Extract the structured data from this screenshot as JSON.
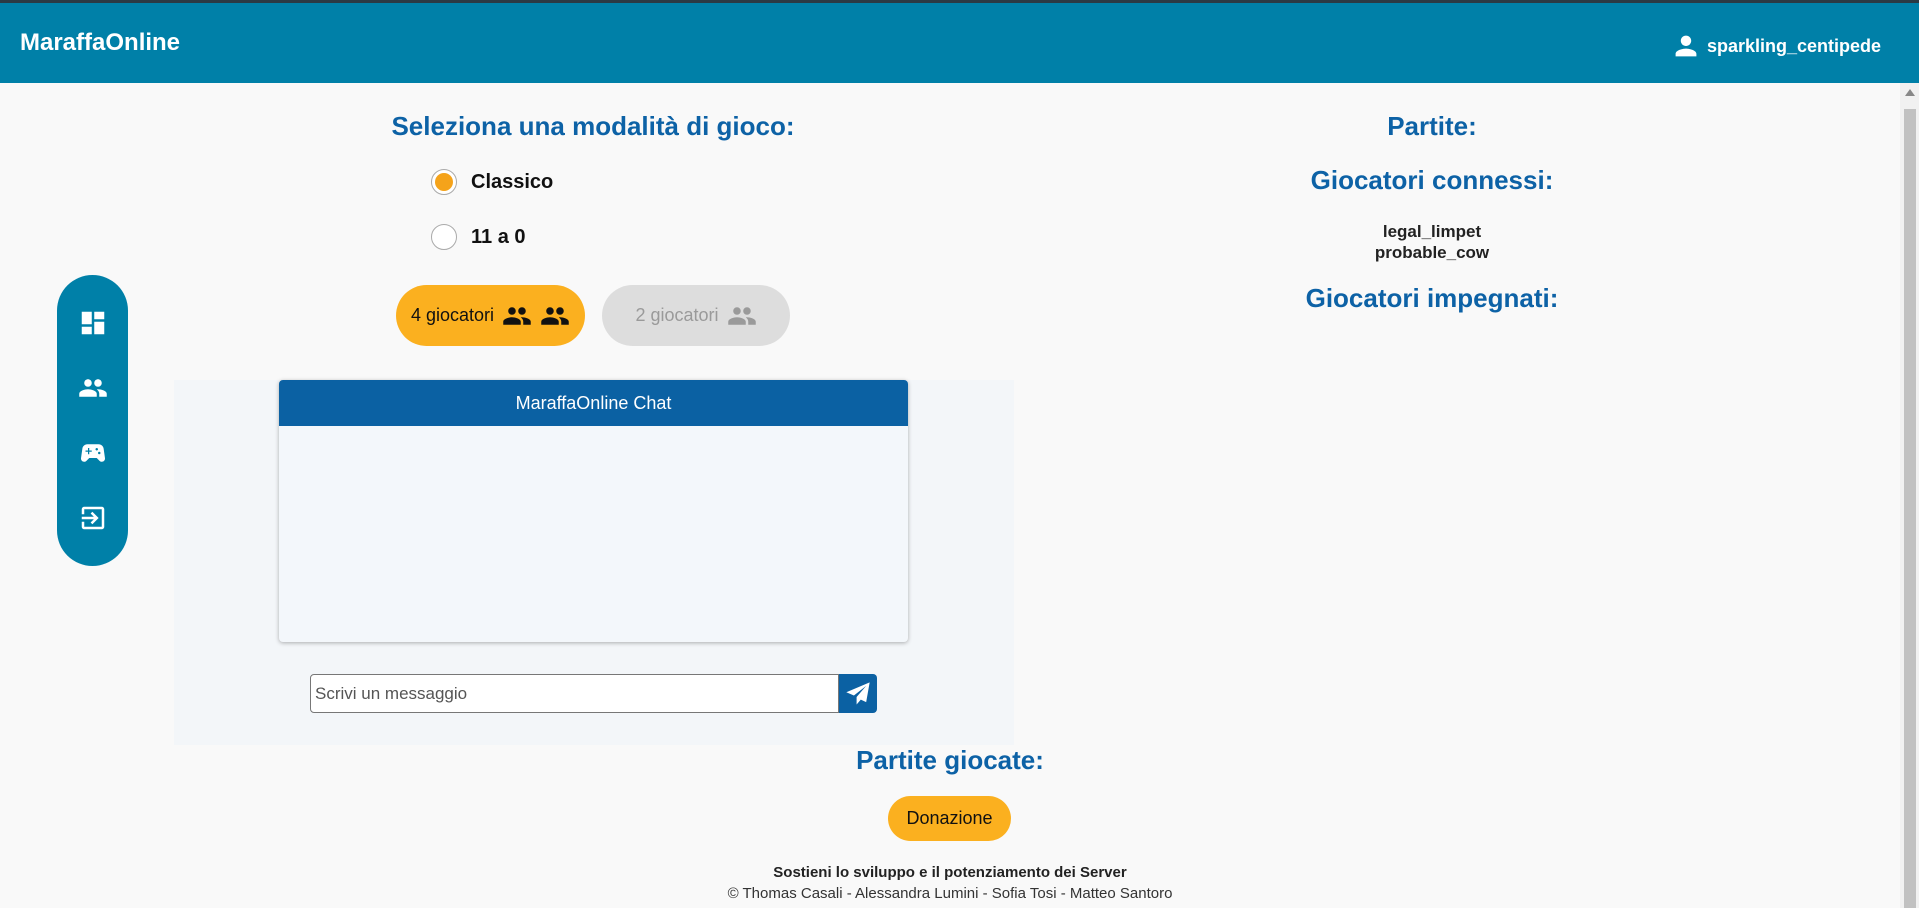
{
  "header": {
    "brand": "MaraffaOnline",
    "username": "sparkling_centipede"
  },
  "sidebar": {
    "items": [
      {
        "icon": "dashboard-icon"
      },
      {
        "icon": "group-icon"
      },
      {
        "icon": "gamepad-icon"
      },
      {
        "icon": "logout-icon"
      }
    ]
  },
  "mode": {
    "title": "Seleziona una modalità di gioco:",
    "options": [
      {
        "label": "Classico",
        "selected": true
      },
      {
        "label": "11 a 0",
        "selected": false
      }
    ]
  },
  "players_buttons": {
    "four": "4 giocatori",
    "two": "2 giocatori"
  },
  "chat": {
    "title": "MaraffaOnline Chat",
    "placeholder": "Scrivi un messaggio"
  },
  "right": {
    "matches_title": "Partite:",
    "connected_title": "Giocatori connessi:",
    "connected_players": [
      "legal_limpet",
      "probable_cow"
    ],
    "busy_title": "Giocatori impegnati:"
  },
  "played_title": "Partite giocate:",
  "donate_label": "Donazione",
  "footer": {
    "support": "Sostieni lo sviluppo e il potenziamento dei Server",
    "credits": "© Thomas Casali - Alessandra Lumini - Sofia Tosi - Matteo Santoro"
  },
  "colors": {
    "header": "#0080a8",
    "title": "#0d62a6",
    "accent": "#fbb01f",
    "chat_header": "#0b61a3"
  }
}
